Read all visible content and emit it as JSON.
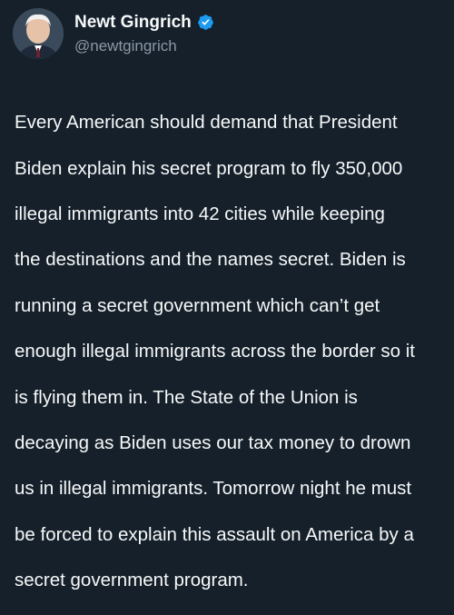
{
  "author": {
    "display_name": "Newt Gingrich",
    "handle": "@newtgingrich",
    "verified_icon": "verified-badge-icon",
    "badge_color": "#1d9bf0"
  },
  "tweet": {
    "lines": [
      "Every American should demand that President",
      "Biden explain his secret program to fly 350,000",
      "illegal immigrants into 42 cities while keeping",
      "the destinations and the names secret. Biden is",
      "running a secret government which can’t get",
      "enough illegal immigrants across the border so it",
      "is flying them in. The State of the Union is",
      "decaying as Biden uses our tax money to drown",
      "us in illegal immigrants. Tomorrow night he must",
      "be forced to explain this assault on America by a",
      "secret government program."
    ]
  },
  "colors": {
    "background": "#15202b",
    "text": "#f7f9f9",
    "secondary_text": "#8b98a5"
  }
}
